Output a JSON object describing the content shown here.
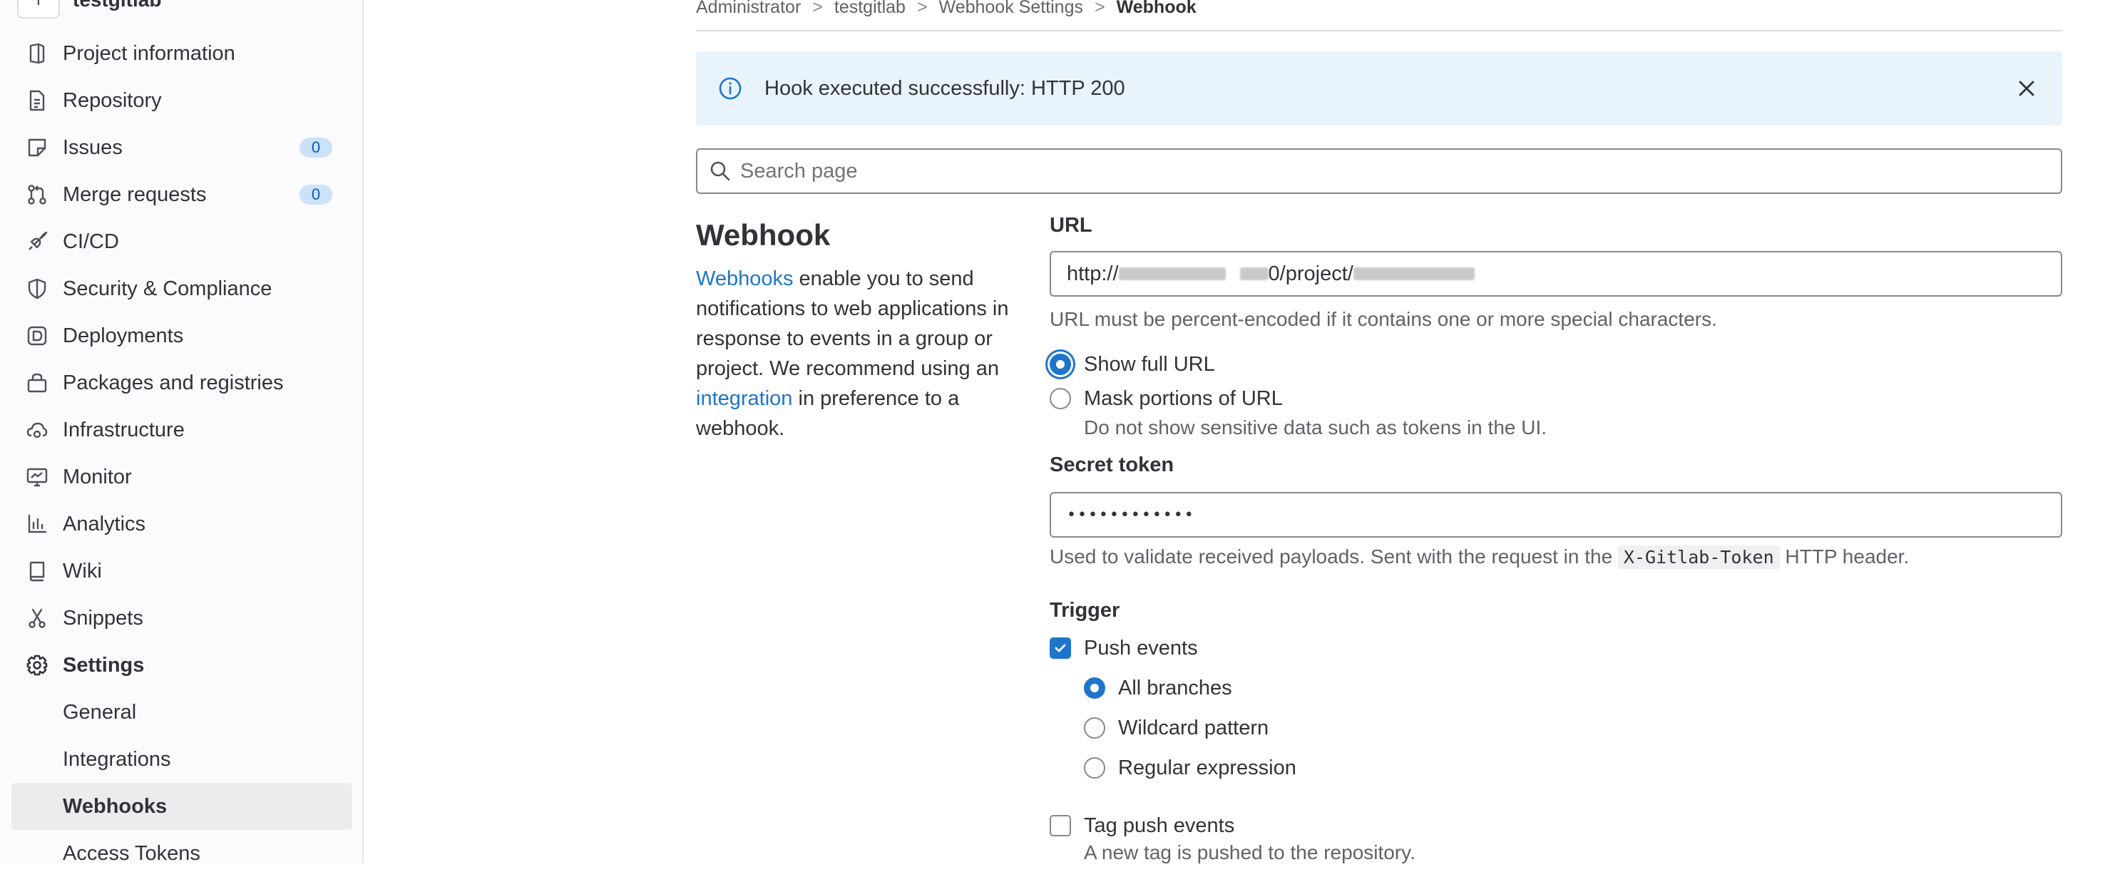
{
  "project": {
    "avatar_letter": "T",
    "name": "testgitlab"
  },
  "sidebar": {
    "items": [
      {
        "label": "Project information",
        "icon": "project-icon"
      },
      {
        "label": "Repository",
        "icon": "doc-icon"
      },
      {
        "label": "Issues",
        "icon": "issues-icon",
        "badge": "0"
      },
      {
        "label": "Merge requests",
        "icon": "merge-request-icon",
        "badge": "0"
      },
      {
        "label": "CI/CD",
        "icon": "rocket-icon"
      },
      {
        "label": "Security & Compliance",
        "icon": "shield-icon"
      },
      {
        "label": "Deployments",
        "icon": "deployments-icon"
      },
      {
        "label": "Packages and registries",
        "icon": "package-icon"
      },
      {
        "label": "Infrastructure",
        "icon": "cloud-gear-icon"
      },
      {
        "label": "Monitor",
        "icon": "monitor-icon"
      },
      {
        "label": "Analytics",
        "icon": "chart-icon"
      },
      {
        "label": "Wiki",
        "icon": "book-icon"
      },
      {
        "label": "Snippets",
        "icon": "scissors-icon"
      },
      {
        "label": "Settings",
        "icon": "gear-icon"
      }
    ],
    "sub_items": [
      {
        "label": "General"
      },
      {
        "label": "Integrations"
      },
      {
        "label": "Webhooks"
      },
      {
        "label": "Access Tokens"
      }
    ]
  },
  "breadcrumb": {
    "items": [
      "Administrator",
      "testgitlab",
      "Webhook Settings",
      "Webhook"
    ],
    "separator": ">"
  },
  "alert": {
    "message": "Hook executed successfully: HTTP 200"
  },
  "search": {
    "placeholder": "Search page"
  },
  "section": {
    "title": "Webhook",
    "desc_link1": "Webhooks",
    "desc_part1": " enable you to send notifications to web applications in response to events in a group or project. We recommend using an ",
    "desc_link2": "integration",
    "desc_part2": " in preference to a webhook."
  },
  "form": {
    "url_label": "URL",
    "url_prefix": "http://",
    "url_mid": "0/project/",
    "url_help": "URL must be percent-encoded if it contains one or more special characters.",
    "show_full_url": "Show full URL",
    "mask_url": "Mask portions of URL",
    "mask_help": "Do not show sensitive data such as tokens in the UI.",
    "secret_label": "Secret token",
    "secret_value": "••••••••••••",
    "secret_help_pre": "Used to validate received payloads. Sent with the request in the ",
    "secret_help_code": "X-Gitlab-Token",
    "secret_help_post": " HTTP header.",
    "trigger_label": "Trigger",
    "push_events": "Push events",
    "all_branches": "All branches",
    "wildcard": "Wildcard pattern",
    "regex": "Regular expression",
    "tag_push": "Tag push events",
    "tag_push_help": "A new tag is pushed to the repository."
  },
  "colors": {
    "accent": "#1f75cb",
    "alert_bg": "#e9f3fc",
    "badge_bg": "#cbe2f9",
    "active_bg": "#ececef"
  }
}
